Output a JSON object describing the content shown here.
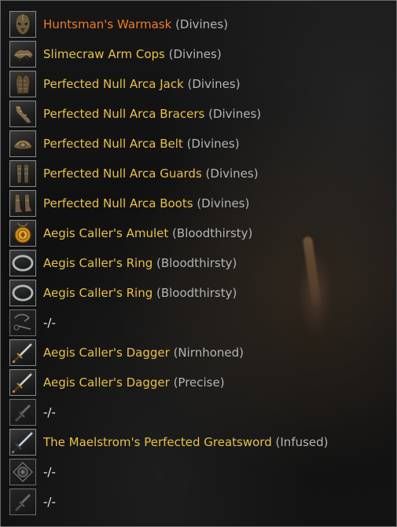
{
  "colors": {
    "item_gold": "#e8c23a",
    "item_orange": "#ee7d22",
    "trait_gray": "#b4b4b4",
    "empty_white": "#e6e6e6"
  },
  "items": [
    {
      "slot": "head",
      "icon": "helmet-mask-icon",
      "name": "Huntsman's Warmask",
      "trait": "(Divines)",
      "quality": "mythic"
    },
    {
      "slot": "shoulders",
      "icon": "shoulder-armor-icon",
      "name": "Slimecraw Arm Cops",
      "trait": "(Divines)",
      "quality": "legendary"
    },
    {
      "slot": "chest",
      "icon": "chest-armor-icon",
      "name": "Perfected Null Arca Jack",
      "trait": "(Divines)",
      "quality": "legendary"
    },
    {
      "slot": "hands",
      "icon": "bracers-icon",
      "name": "Perfected Null Arca Bracers",
      "trait": "(Divines)",
      "quality": "legendary"
    },
    {
      "slot": "waist",
      "icon": "belt-icon",
      "name": "Perfected Null Arca Belt",
      "trait": "(Divines)",
      "quality": "legendary"
    },
    {
      "slot": "legs",
      "icon": "leg-guards-icon",
      "name": "Perfected Null Arca Guards",
      "trait": "(Divines)",
      "quality": "legendary"
    },
    {
      "slot": "feet",
      "icon": "boots-icon",
      "name": "Perfected Null Arca Boots",
      "trait": "(Divines)",
      "quality": "legendary"
    },
    {
      "slot": "neck",
      "icon": "amulet-icon",
      "name": "Aegis Caller's Amulet",
      "trait": "(Bloodthirsty)",
      "quality": "legendary"
    },
    {
      "slot": "ring1",
      "icon": "ring-icon",
      "name": "Aegis Caller's Ring",
      "trait": "(Bloodthirsty)",
      "quality": "legendary"
    },
    {
      "slot": "ring2",
      "icon": "ring-icon",
      "name": "Aegis Caller's Ring",
      "trait": "(Bloodthirsty)",
      "quality": "legendary"
    },
    {
      "slot": "poison1",
      "icon": "empty-slot-icon",
      "name": "",
      "trait": "",
      "empty_text": "-/-",
      "quality": "empty"
    },
    {
      "slot": "main-hand",
      "icon": "dagger-icon",
      "name": "Aegis Caller's Dagger",
      "trait": "(Nirnhoned)",
      "quality": "legendary"
    },
    {
      "slot": "off-hand",
      "icon": "dagger-icon",
      "name": "Aegis Caller's Dagger",
      "trait": "(Precise)",
      "quality": "legendary"
    },
    {
      "slot": "poison2",
      "icon": "empty-slot-icon",
      "name": "",
      "trait": "",
      "empty_text": "-/-",
      "quality": "empty"
    },
    {
      "slot": "backup-main",
      "icon": "greatsword-icon",
      "name": "The Maelstrom's Perfected Greatsword",
      "trait": "(Infused)",
      "quality": "legendary"
    },
    {
      "slot": "backup-off",
      "icon": "empty-offhand-icon",
      "name": "",
      "trait": "",
      "empty_text": "-/-",
      "quality": "empty"
    },
    {
      "slot": "backup-poison",
      "icon": "empty-slot-icon",
      "name": "",
      "trait": "",
      "empty_text": "-/-",
      "quality": "empty"
    }
  ]
}
